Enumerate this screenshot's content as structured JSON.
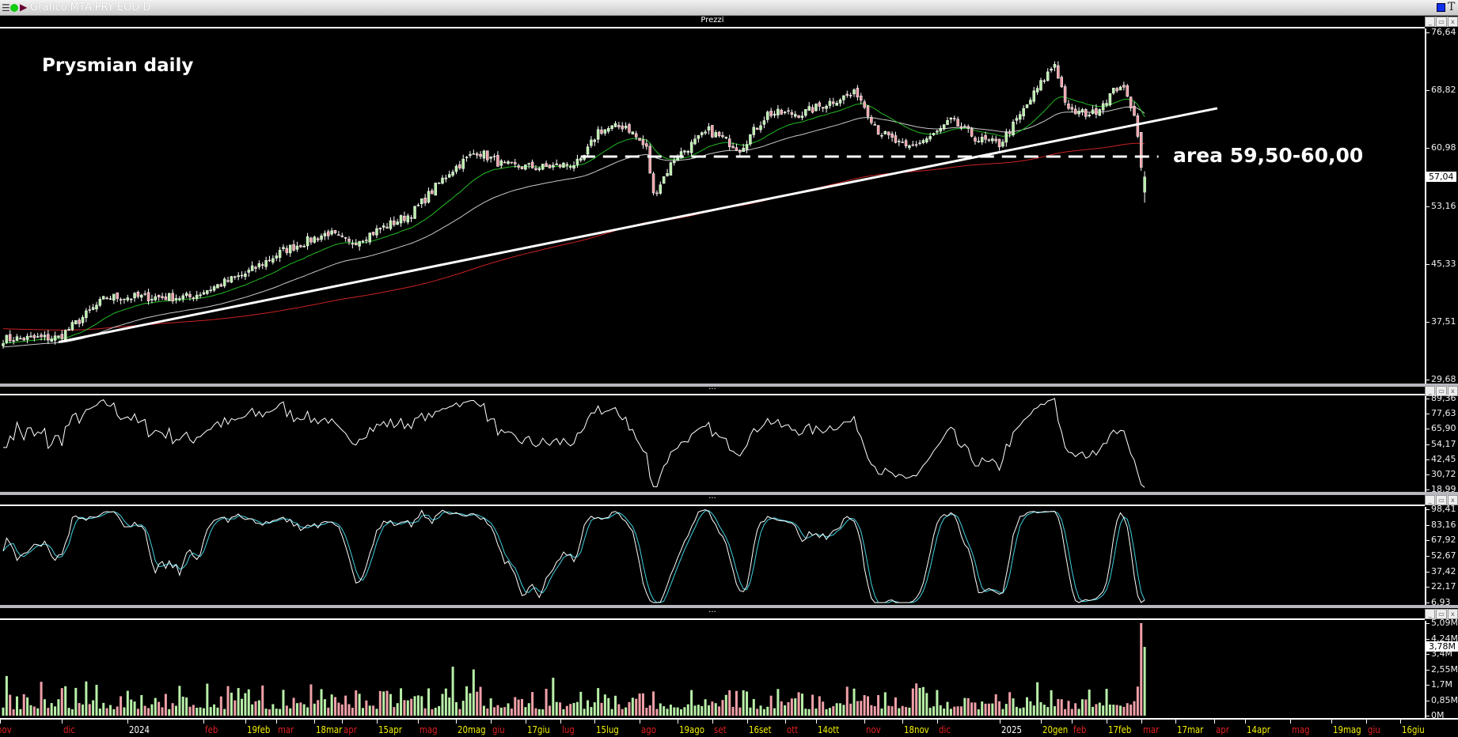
{
  "window": {
    "title": "Grafico MTA.PRY EOD D",
    "menu_icon": "hamburger-icon",
    "status_icon": "green-dot-icon",
    "arrow_icon": "play-arrow-icon"
  },
  "panels": {
    "price_title": "Prezzi",
    "indicator_title": "..."
  },
  "annotations": {
    "title": "Prysmian daily",
    "level": "area 59,50-60,00"
  },
  "colors": {
    "up": "#b8f0a8",
    "down": "#f0a0a8",
    "ma_fast": "#22bb22",
    "ma_mid": "#c8c8c8",
    "ma_slow": "#cc2222",
    "stoch_k": "#ffffff",
    "stoch_d": "#40d0e0",
    "month": "#e02020",
    "day": "#f0f000",
    "year": "#ffffff"
  },
  "chart_data": [
    {
      "type": "candlestick",
      "name": "Prezzi",
      "ylim": [
        29.68,
        76.64
      ],
      "y_ticks": [
        "76,64",
        "68,82",
        "60,98",
        "53,16",
        "45,33",
        "37,51",
        "29,68"
      ],
      "last_value": "57,04",
      "close_keypoints": [
        [
          0,
          35.4
        ],
        [
          16,
          35.6
        ],
        [
          22,
          37.9
        ],
        [
          30,
          41.0
        ],
        [
          38,
          41.0
        ],
        [
          54,
          41.0
        ],
        [
          70,
          44.1
        ],
        [
          81,
          47.2
        ],
        [
          94,
          49.6
        ],
        [
          100,
          48.1
        ],
        [
          110,
          50.3
        ],
        [
          118,
          52.1
        ],
        [
          129,
          57.7
        ],
        [
          137,
          60.5
        ],
        [
          145,
          58.5
        ],
        [
          156,
          58.3
        ],
        [
          167,
          58.9
        ],
        [
          172,
          63.2
        ],
        [
          180,
          63.9
        ],
        [
          186,
          60.8
        ],
        [
          188,
          54.6
        ],
        [
          194,
          59.5
        ],
        [
          204,
          63.2
        ],
        [
          213,
          60.8
        ],
        [
          221,
          65.5
        ],
        [
          231,
          65.5
        ],
        [
          242,
          67.6
        ],
        [
          247,
          68.2
        ],
        [
          253,
          63.2
        ],
        [
          261,
          60.8
        ],
        [
          269,
          62.6
        ],
        [
          274,
          64.5
        ],
        [
          282,
          62.0
        ],
        [
          288,
          61.4
        ],
        [
          293,
          64.5
        ],
        [
          299,
          68.8
        ],
        [
          304,
          72.2
        ],
        [
          308,
          65.7
        ],
        [
          315,
          65.5
        ],
        [
          323,
          69.4
        ],
        [
          327,
          65.7
        ],
        [
          329,
          58.9
        ],
        [
          330,
          57.04
        ]
      ],
      "trendline": {
        "from": [
          16,
          35.0
        ],
        "to": [
          351,
          66.2
        ]
      },
      "horizontal_level": {
        "price": 59.75,
        "from": 167,
        "to": 334
      },
      "moving_averages": [
        "fast",
        "mid",
        "slow"
      ]
    },
    {
      "type": "line",
      "name": "RSI",
      "ylim": [
        18.99,
        89.36
      ],
      "y_ticks": [
        "89,36",
        "77,63",
        "65,90",
        "54,17",
        "42,45",
        "30,72",
        "18,99"
      ]
    },
    {
      "type": "line",
      "name": "Stocastico",
      "ylim": [
        6.93,
        98.41
      ],
      "y_ticks": [
        "98,41",
        "83,16",
        "67,92",
        "52,67",
        "37,42",
        "22,17",
        "6,93"
      ]
    },
    {
      "type": "bar",
      "name": "Volume",
      "ylim": [
        0,
        5.09
      ],
      "y_ticks": [
        "5,09M",
        "4,24M",
        "3,4M",
        "2,55M",
        "1,7M",
        "0,85M",
        "0M"
      ],
      "last_value": "3,78M",
      "last_bars_millions": [
        1.6,
        5.09,
        3.78
      ]
    }
  ],
  "x_labels": [
    [
      "nov",
      -1,
      "m"
    ],
    [
      "dic",
      17,
      "m"
    ],
    [
      "2024",
      36,
      "y"
    ],
    [
      "feb",
      58,
      "m"
    ],
    [
      "19feb",
      70,
      "d"
    ],
    [
      "mar",
      79,
      "m"
    ],
    [
      "18mar",
      90,
      "d"
    ],
    [
      "apr",
      98,
      "m"
    ],
    [
      "15apr",
      108,
      "d"
    ],
    [
      "mag",
      120,
      "m"
    ],
    [
      "20mag",
      131,
      "d"
    ],
    [
      "giu",
      141,
      "m"
    ],
    [
      "17giu",
      151,
      "d"
    ],
    [
      "lug",
      161,
      "m"
    ],
    [
      "15lug",
      171,
      "d"
    ],
    [
      "ago",
      184,
      "m"
    ],
    [
      "19ago",
      195,
      "d"
    ],
    [
      "set",
      205,
      "m"
    ],
    [
      "16set",
      215,
      "d"
    ],
    [
      "ott",
      226,
      "m"
    ],
    [
      "14ott",
      235,
      "d"
    ],
    [
      "nov",
      249,
      "m"
    ],
    [
      "18nov",
      260,
      "d"
    ],
    [
      "dic",
      270,
      "m"
    ],
    [
      "2025",
      288,
      "y"
    ],
    [
      "20gen",
      300,
      "d"
    ],
    [
      "feb",
      309,
      "m"
    ],
    [
      "17feb",
      319,
      "d"
    ],
    [
      "mar",
      329,
      "m"
    ],
    [
      "17mar",
      339,
      "d"
    ],
    [
      "apr",
      350,
      "m"
    ],
    [
      "14apr",
      359,
      "d"
    ],
    [
      "mag",
      372,
      "m"
    ],
    [
      "19mag",
      384,
      "d"
    ],
    [
      "giu",
      394,
      "m"
    ],
    [
      "16giu",
      404,
      "d"
    ]
  ]
}
